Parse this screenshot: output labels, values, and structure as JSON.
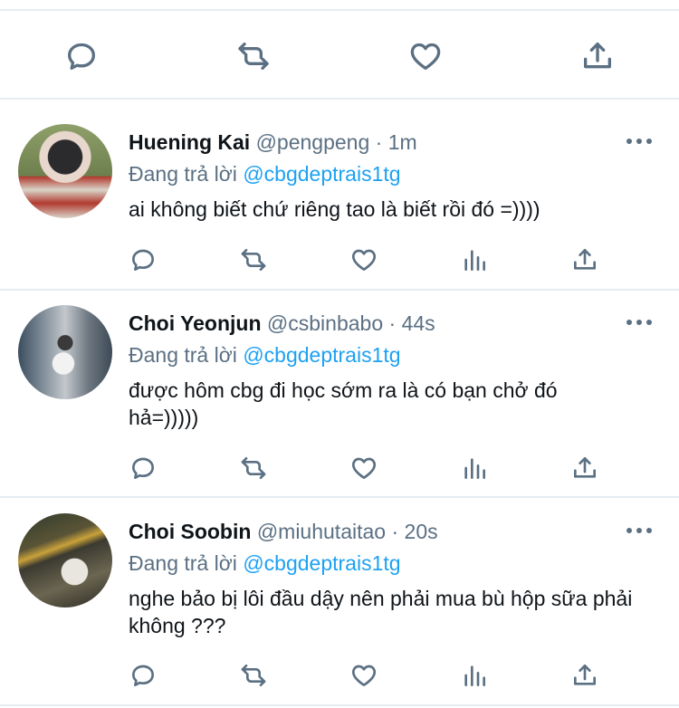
{
  "tweets": [
    {
      "name": "Huening Kai",
      "handle": "@pengpeng",
      "separator": "·",
      "time": "1m",
      "reply_prefix": "Đang trả lời",
      "reply_mention": "@cbgdeptrais1tg",
      "text": "ai không biết chứ riêng tao là biết rồi đó =))))",
      "avatar_bg": "#7a8c5a"
    },
    {
      "name": "Choi Yeonjun",
      "handle": "@csbinbabo",
      "separator": "·",
      "time": "44s",
      "reply_prefix": "Đang trả lời",
      "reply_mention": "@cbgdeptrais1tg",
      "text": "được hôm cbg đi học sớm ra là có bạn chở đó hả=)))))",
      "avatar_bg": "#8a8f96"
    },
    {
      "name": "Choi Soobin",
      "handle": "@miuhutaitao",
      "separator": "·",
      "time": "20s",
      "reply_prefix": "Đang trả lời",
      "reply_mention": "@cbgdeptrais1tg",
      "text": "nghe bảo bị lôi đầu dậy nên phải mua bù hộp sữa phải không ???",
      "avatar_bg": "#4a4536"
    }
  ],
  "colors": {
    "accent": "#1da1f2",
    "secondary_text": "#5b7083",
    "divider": "#e6ecf0"
  }
}
